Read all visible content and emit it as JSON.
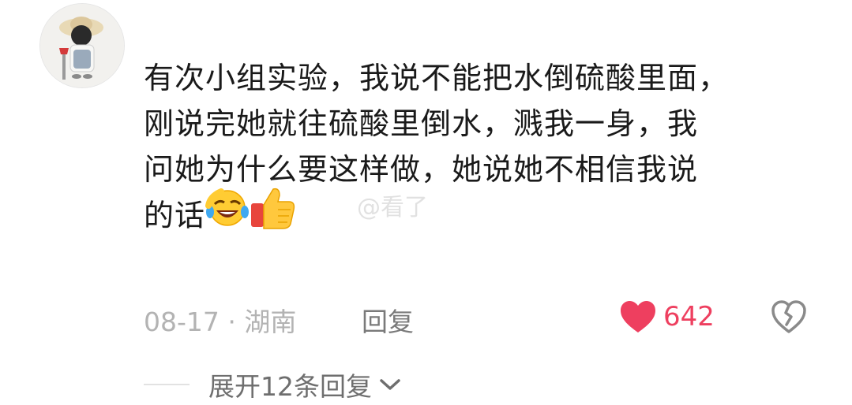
{
  "comment": {
    "lines": [
      "有次小组实验，我说不能把水倒硫酸里面，",
      "刚说完她就往硫酸里倒水，溅我一身，我",
      "问她为什么要这样做，她说她不相信我说",
      "的话"
    ],
    "emojis": [
      "rofl-emoji",
      "thumbs-up-emoji"
    ]
  },
  "meta": {
    "date_location": "08-17 · 湖南",
    "reply_label": "回复"
  },
  "likes": {
    "count": "642",
    "color": "#ee3f5f"
  },
  "expand": {
    "label": "展开12条回复"
  },
  "watermark": "@看了"
}
